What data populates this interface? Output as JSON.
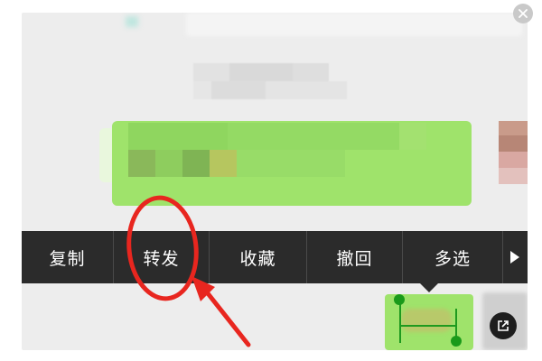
{
  "context_menu": {
    "items": [
      {
        "label": "复制"
      },
      {
        "label": "转发"
      },
      {
        "label": "收藏"
      },
      {
        "label": "撤回"
      },
      {
        "label": "多选"
      }
    ],
    "more_icon": "triangle-right-icon"
  },
  "annotation": {
    "color": "#e8261f",
    "highlighted_item": "转发"
  },
  "colors": {
    "menu_background": "#2b2b2b",
    "bubble_green": "#9fe36b",
    "chat_background": "#ededed",
    "selection_handle": "#1a9a1a"
  },
  "icons": {
    "close": "close-icon",
    "open_external": "open-external-icon"
  }
}
